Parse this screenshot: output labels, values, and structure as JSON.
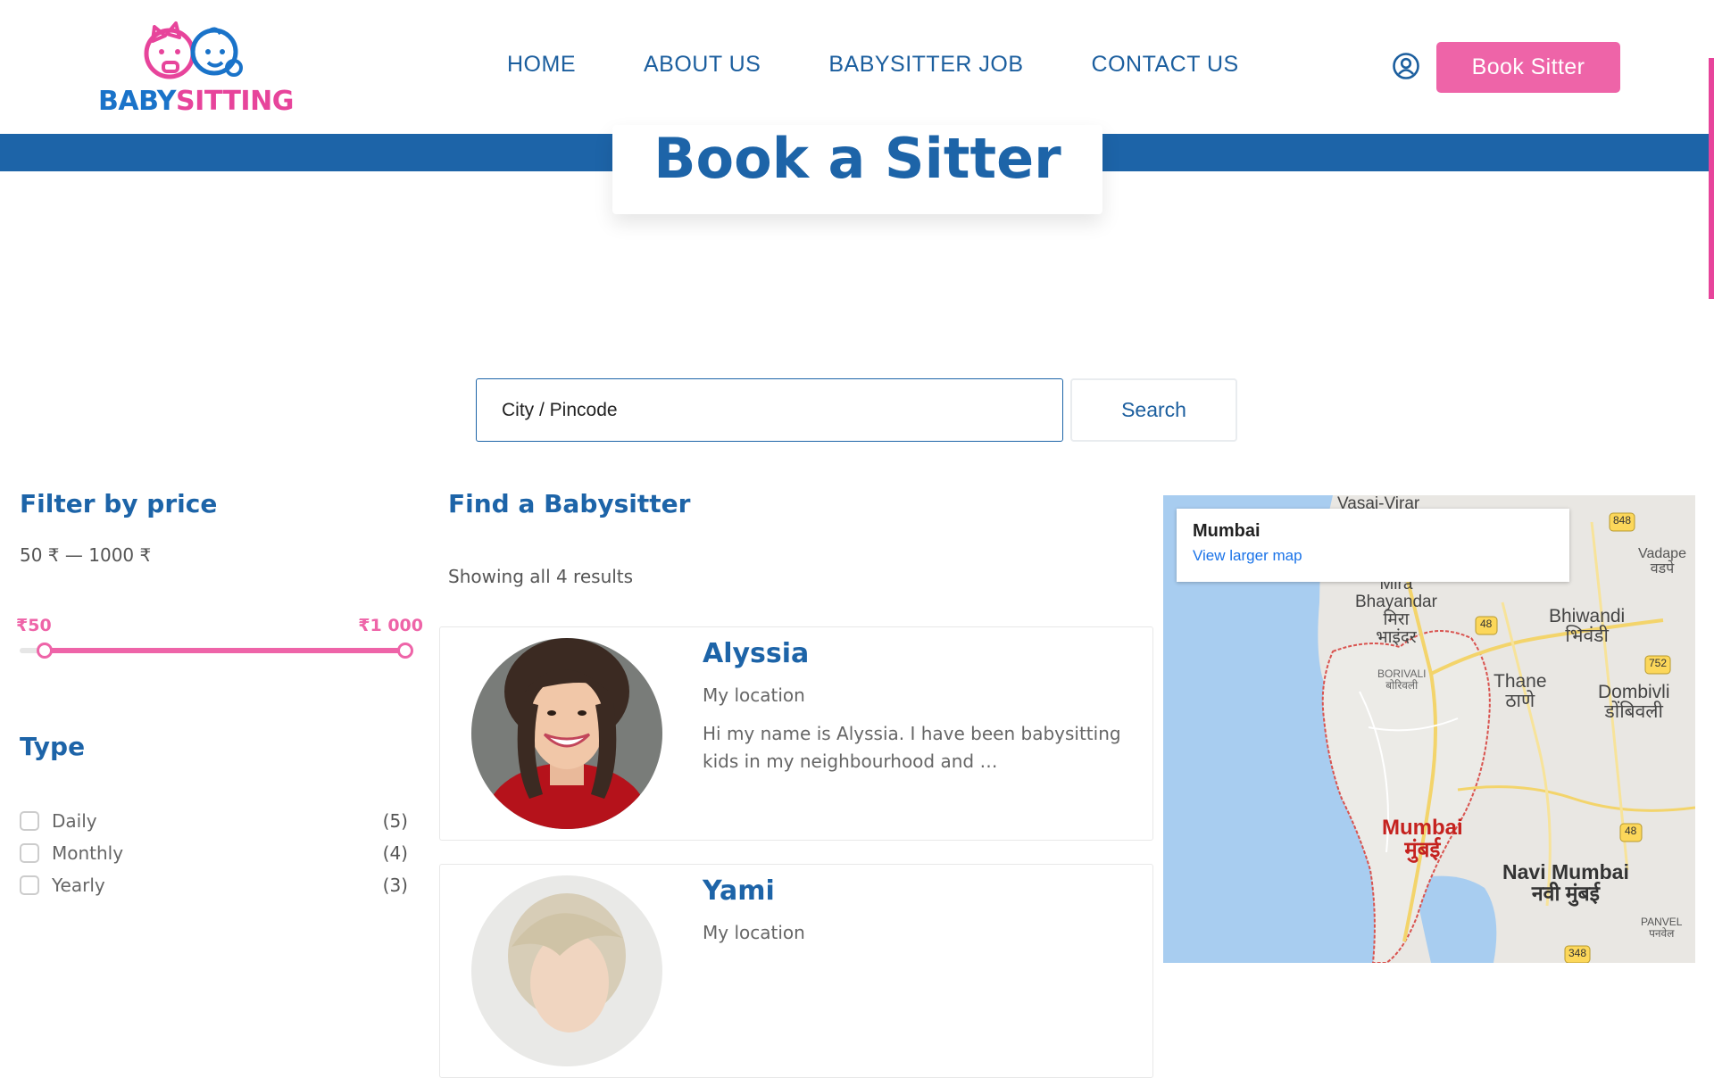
{
  "brand": {
    "part1": "BABY",
    "part2": "SITTING"
  },
  "nav": {
    "home": "HOME",
    "about": "ABOUT US",
    "job": "BABYSITTER JOB",
    "contact": "CONTACT US"
  },
  "header": {
    "book_button": "Book Sitter"
  },
  "page_title": "Book a Sitter",
  "search": {
    "placeholder": "City / Pincode",
    "button": "Search"
  },
  "filter": {
    "title": "Filter by price",
    "range_text": "50 ₹ — 1000 ₹",
    "min_label": "₹50",
    "max_label": "₹1 000",
    "min_value": 50,
    "max_value": 1000
  },
  "type": {
    "title": "Type",
    "options": [
      {
        "label": "Daily",
        "count": "(5)"
      },
      {
        "label": "Monthly",
        "count": "(4)"
      },
      {
        "label": "Yearly",
        "count": "(3)"
      }
    ]
  },
  "results": {
    "title": "Find a Babysitter",
    "count_text": "Showing all 4 results",
    "items": [
      {
        "name": "Alyssia",
        "location": "My location",
        "description": "Hi my name is Alyssia. I have been babysitting kids in my neighbourhood and …"
      },
      {
        "name": "Yami",
        "location": "My location",
        "description": ""
      }
    ]
  },
  "map": {
    "place": "Mumbai",
    "link": "View larger map",
    "labels": {
      "vasai": "Vasai-Virar",
      "vadape": "Vadape\nवडपे",
      "mira": "Mira\nBhayandar\nमिरा\nभाइंदर",
      "bhiwandi": "Bhiwandi\nभिवंडी",
      "borivali": "BORIVALI\nबोरिवली",
      "thane": "Thane\nठाणे",
      "dombivli": "Dombivli\nडोंबिवली",
      "mumbai": "Mumbai\nमुंबई",
      "navi": "Navi Mumbai\nनवी मुंबई",
      "panvel": "PANVEL\nपनवेल",
      "r848": "848",
      "r48a": "48",
      "r752": "752",
      "r48b": "48",
      "r348": "348"
    }
  },
  "colors": {
    "primary": "#1d64a8",
    "accent": "#ee64a8",
    "band": "#1d64a8"
  }
}
